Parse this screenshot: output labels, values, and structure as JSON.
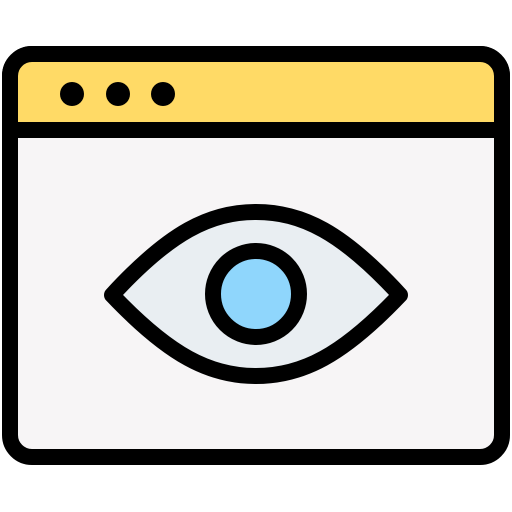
{
  "icon": {
    "name": "browser-eye-icon",
    "colors": {
      "outline": "#000000",
      "title_bar": "#FFDA66",
      "window_body": "#F7F5F6",
      "eye_white": "#E9EEF2",
      "iris": "#8FD6FC",
      "control_dots": "#000000"
    },
    "parts": {
      "window": "browser-window-icon",
      "title_bar": "title-bar",
      "dots": [
        "window-dot-1",
        "window-dot-2",
        "window-dot-3"
      ],
      "eye": "eye-icon",
      "iris": "iris-icon"
    }
  }
}
